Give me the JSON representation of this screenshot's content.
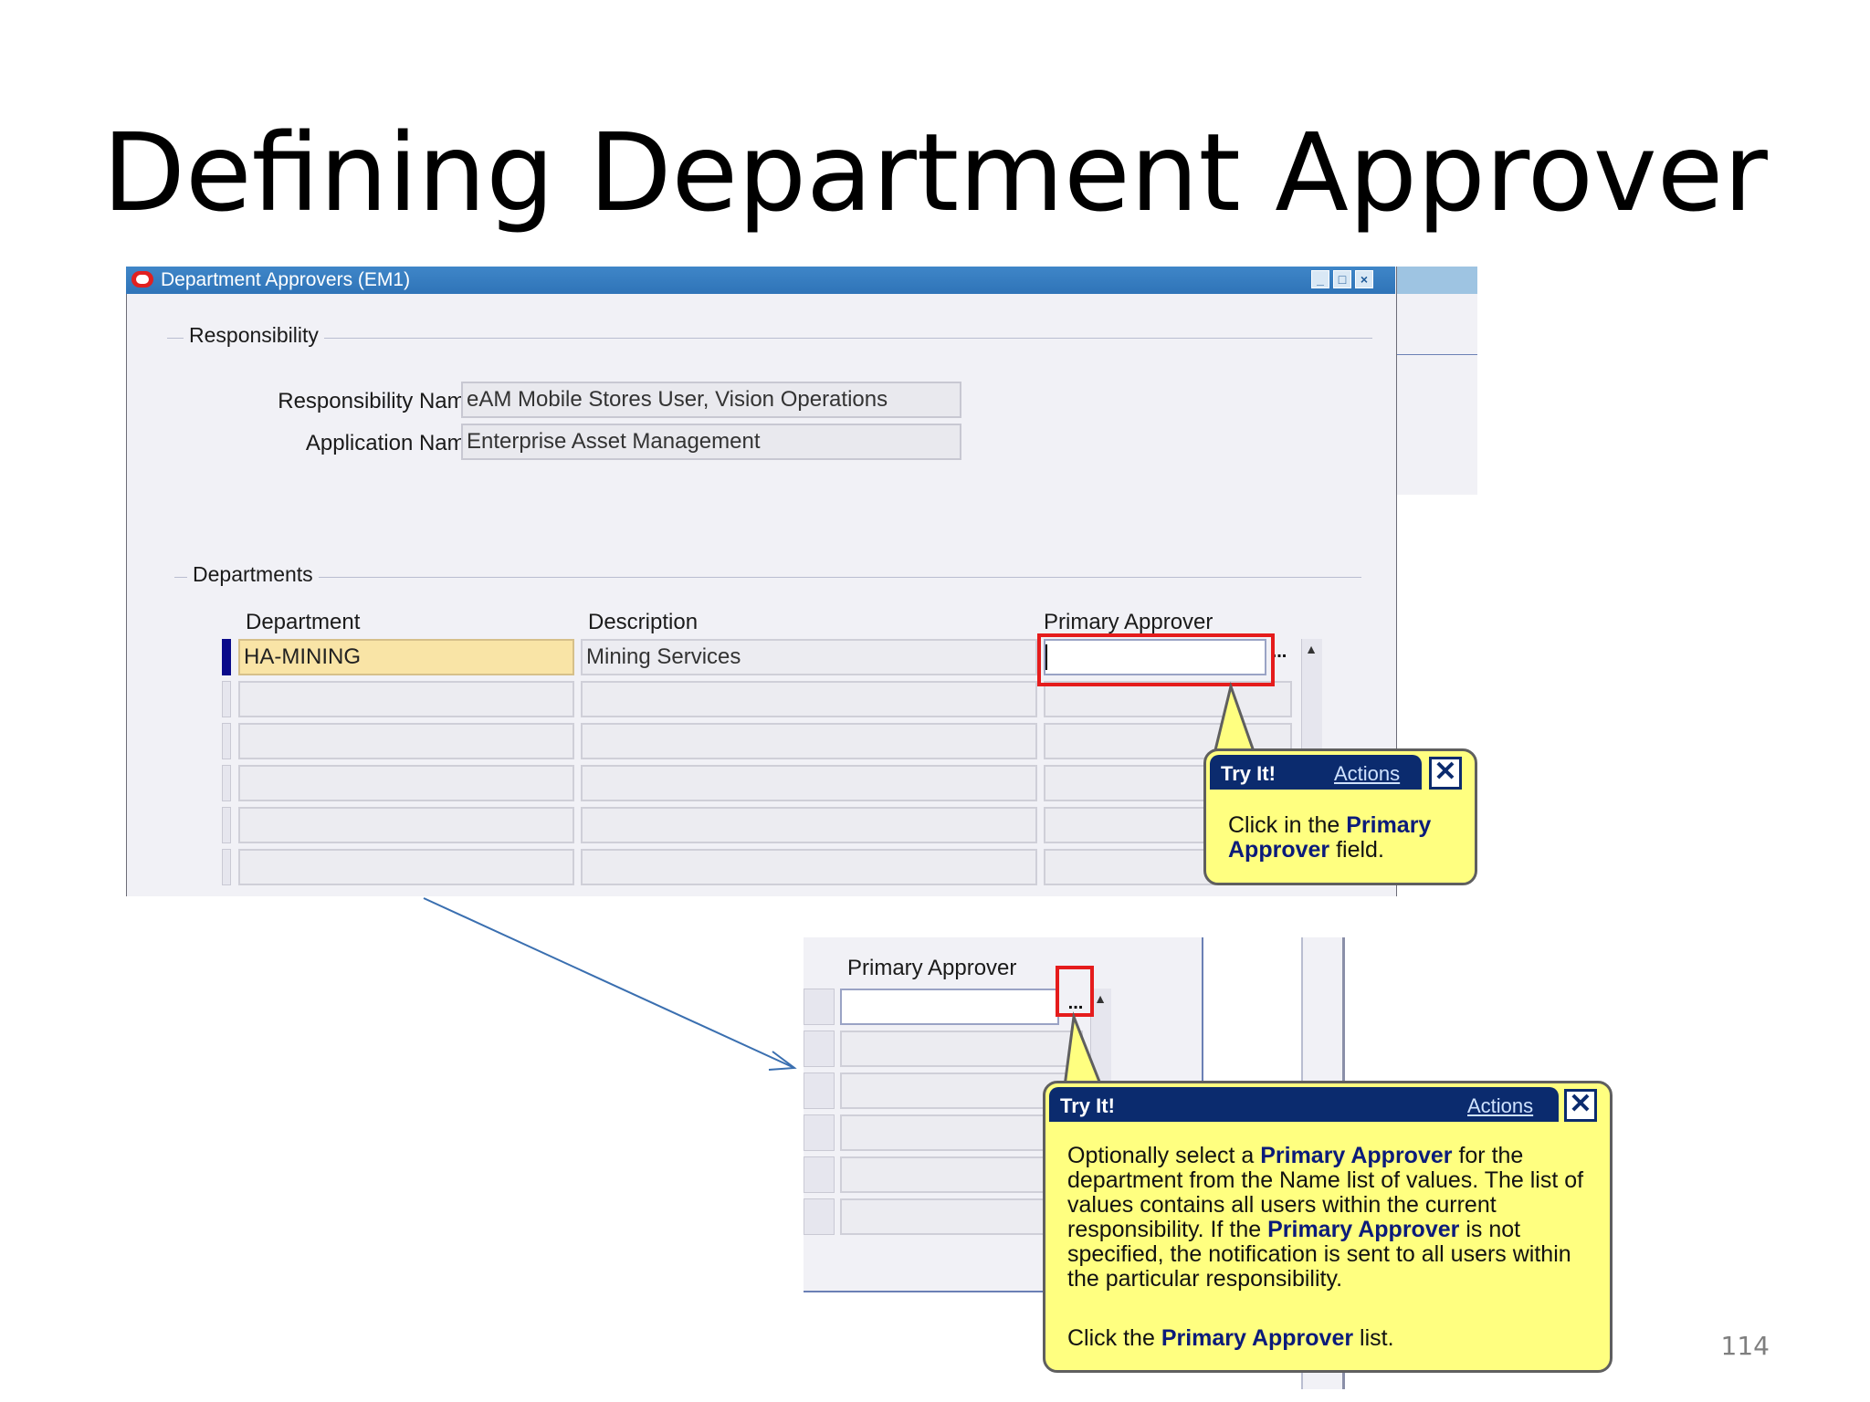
{
  "slide": {
    "title": "Defining Department Approver",
    "page_number": "114"
  },
  "window": {
    "title": "Department Approvers (EM1)",
    "buttons": [
      "minimize",
      "maximize",
      "close"
    ]
  },
  "responsibility": {
    "section_label": "Responsibility",
    "responsibility_name_label": "Responsibility Name",
    "responsibility_name_value": "eAM Mobile Stores User, Vision Operations",
    "application_name_label": "Application Name",
    "application_name_value": "Enterprise Asset Management"
  },
  "departments": {
    "section_label": "Departments",
    "columns": [
      "Department",
      "Description",
      "Primary Approver"
    ],
    "rows": [
      {
        "department": "HA-MINING",
        "description": "Mining Services",
        "primary_approver": ""
      },
      {
        "department": "",
        "description": "",
        "primary_approver": ""
      },
      {
        "department": "",
        "description": "",
        "primary_approver": ""
      },
      {
        "department": "",
        "description": "",
        "primary_approver": ""
      },
      {
        "department": "",
        "description": "",
        "primary_approver": ""
      },
      {
        "department": "",
        "description": "",
        "primary_approver": ""
      }
    ],
    "lov_button": "..."
  },
  "callout1": {
    "title": "Try It!",
    "actions": "Actions",
    "close": "X",
    "text_pre": "Click in the ",
    "text_bold": "Primary Approver",
    "text_post": " field."
  },
  "zoom": {
    "column_label": "Primary Approver",
    "lov_button": "..."
  },
  "callout2": {
    "title": "Try It!",
    "actions": "Actions",
    "close": "X",
    "p1_a": "Optionally select a ",
    "p1_b": "Primary Approver",
    "p1_c": " for the department from the Name list of values. The list of values contains all users within the current responsibility. If the ",
    "p1_d": "Primary Approver",
    "p1_e": " is not specified, the notification is sent to all users within the particular responsibility.",
    "p2_a": "Click the ",
    "p2_b": "Primary Approver",
    "p2_c": " list."
  },
  "colors": {
    "titlebar": "#2f74b8",
    "callout_bg": "#ffff80",
    "callout_header": "#0b2b6e",
    "highlight": "#e51c1c",
    "active_cell": "#f9e4a6"
  }
}
